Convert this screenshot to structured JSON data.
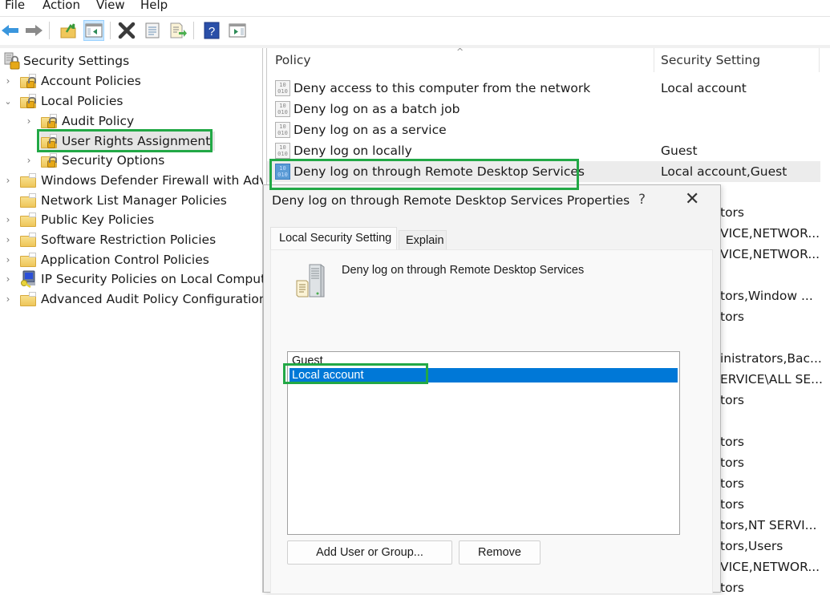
{
  "menu": {
    "items": [
      "File",
      "Action",
      "View",
      "Help"
    ]
  },
  "toolbar": {
    "buttons": [
      {
        "name": "back-button",
        "icon": "back-arrow-icon"
      },
      {
        "name": "forward-button",
        "icon": "forward-arrow-icon"
      },
      {
        "name": "up-one-level-button",
        "icon": "up-folder-icon"
      },
      {
        "name": "show-hide-console-tree-button",
        "icon": "console-tree-icon",
        "active": true
      },
      {
        "name": "delete-button",
        "icon": "delete-x-icon"
      },
      {
        "name": "properties-button",
        "icon": "properties-icon"
      },
      {
        "name": "export-list-button",
        "icon": "export-list-icon"
      },
      {
        "name": "help-button",
        "icon": "help-icon"
      },
      {
        "name": "show-hide-action-pane-button",
        "icon": "action-pane-icon"
      }
    ]
  },
  "tree": {
    "root": "Security Settings",
    "items": [
      {
        "label": "Account Policies",
        "level": 1,
        "expander": "collapsed",
        "icon": "locked-folder-icon"
      },
      {
        "label": "Local Policies",
        "level": 1,
        "expander": "expanded",
        "icon": "locked-folder-icon"
      },
      {
        "label": "Audit Policy",
        "level": 2,
        "expander": "collapsed",
        "icon": "locked-folder-icon"
      },
      {
        "label": "User Rights Assignment",
        "level": 2,
        "expander": "none",
        "icon": "locked-folder-icon",
        "selected": true
      },
      {
        "label": "Security Options",
        "level": 2,
        "expander": "collapsed",
        "icon": "locked-folder-icon"
      },
      {
        "label": "Windows Defender Firewall with Advanced Security",
        "level": 1,
        "expander": "collapsed",
        "icon": "folder-icon"
      },
      {
        "label": "Network List Manager Policies",
        "level": 1,
        "expander": "none",
        "icon": "folder-icon"
      },
      {
        "label": "Public Key Policies",
        "level": 1,
        "expander": "collapsed",
        "icon": "folder-icon"
      },
      {
        "label": "Software Restriction Policies",
        "level": 1,
        "expander": "collapsed",
        "icon": "folder-icon"
      },
      {
        "label": "Application Control Policies",
        "level": 1,
        "expander": "collapsed",
        "icon": "folder-icon"
      },
      {
        "label": "IP Security Policies on Local Computer",
        "level": 1,
        "expander": "collapsed",
        "icon": "ip-security-icon"
      },
      {
        "label": "Advanced Audit Policy Configuration",
        "level": 1,
        "expander": "collapsed",
        "icon": "folder-icon"
      }
    ]
  },
  "list": {
    "columns": [
      "Policy",
      "Security Setting"
    ],
    "rows": [
      {
        "policy": "Deny access to this computer from the network",
        "setting": "Local account"
      },
      {
        "policy": "Deny log on as a batch job",
        "setting": ""
      },
      {
        "policy": "Deny log on as a service",
        "setting": ""
      },
      {
        "policy": "Deny log on locally",
        "setting": "Guest"
      },
      {
        "policy": "Deny log on through Remote Desktop Services",
        "setting": "Local account,Guest",
        "selected": true
      }
    ],
    "hidden_setting_tails": [
      "tors",
      "VICE,NETWOR...",
      "VICE,NETWOR...",
      "",
      "tors,Window ...",
      "tors",
      "",
      "inistrators,Bac...",
      "ERVICE\\ALL SE...",
      "tors",
      "",
      "tors",
      "tors",
      "tors",
      "tors",
      "tors,NT SERVI...",
      "tors,Users",
      "VICE,NETWOR...",
      "tors"
    ]
  },
  "dialog": {
    "title": "Deny log on through Remote Desktop Services Properties",
    "help_glyph": "?",
    "close_glyph": "✕",
    "tabs": [
      "Local Security Setting",
      "Explain"
    ],
    "active_tab": "Local Security Setting",
    "policy_name": "Deny log on through Remote Desktop Services",
    "members": [
      {
        "name": "Guest",
        "selected": false
      },
      {
        "name": "Local account",
        "selected": true
      }
    ],
    "add_button": "Add User or Group...",
    "remove_button": "Remove"
  },
  "colors": {
    "highlight_box": "#22a846",
    "selection_blue": "#0078d7",
    "tree_selected": "#e5e5e5"
  }
}
